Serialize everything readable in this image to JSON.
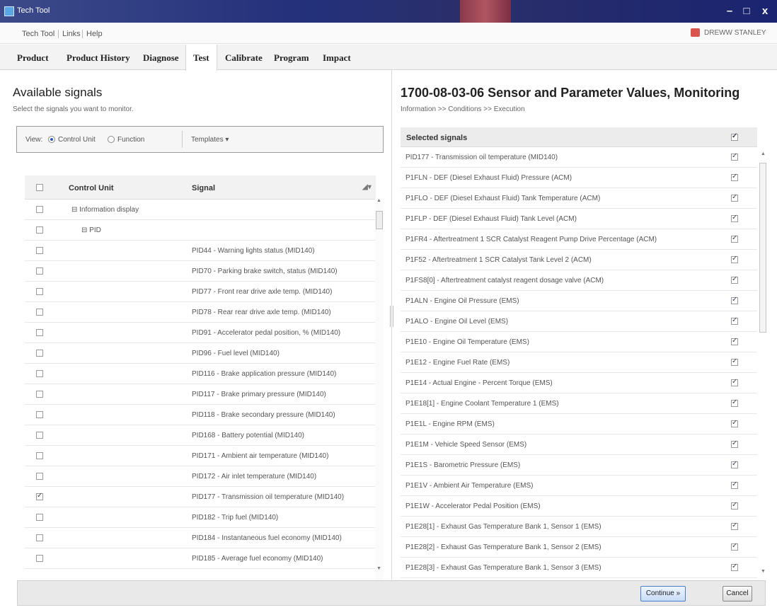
{
  "window": {
    "title": "Tech Tool"
  },
  "menu": {
    "items": [
      "Tech Tool",
      "Links",
      "Help"
    ],
    "user": "DREWW STANLEY"
  },
  "tabs": [
    "Product",
    "Product History",
    "Diagnose",
    "Test",
    "Calibrate",
    "Program",
    "Impact"
  ],
  "active_tab": "Test",
  "left": {
    "title": "Available signals",
    "subtitle": "Select the signals you want to monitor.",
    "view_label": "View:",
    "view_options": [
      "Control Unit",
      "Function"
    ],
    "view_selected": "Control Unit",
    "templates_label": "Templates ▾",
    "columns": {
      "control_unit": "Control Unit",
      "signal": "Signal"
    },
    "rows": [
      {
        "unit": "⊟ Information display",
        "signal": "",
        "checked": false
      },
      {
        "unit": "⊟ PID",
        "signal": "",
        "checked": false
      },
      {
        "unit": "",
        "signal": "PID44 - Warning lights status (MID140)",
        "checked": false
      },
      {
        "unit": "",
        "signal": "PID70 - Parking brake switch, status (MID140)",
        "checked": false
      },
      {
        "unit": "",
        "signal": "PID77 - Front rear drive axle temp. (MID140)",
        "checked": false
      },
      {
        "unit": "",
        "signal": "PID78 - Rear rear drive axle temp. (MID140)",
        "checked": false
      },
      {
        "unit": "",
        "signal": "PID91 - Accelerator pedal position, % (MID140)",
        "checked": false
      },
      {
        "unit": "",
        "signal": "PID96 - Fuel level (MID140)",
        "checked": false
      },
      {
        "unit": "",
        "signal": "PID116 - Brake application pressure (MID140)",
        "checked": false
      },
      {
        "unit": "",
        "signal": "PID117 - Brake primary pressure (MID140)",
        "checked": false
      },
      {
        "unit": "",
        "signal": "PID118 - Brake secondary pressure (MID140)",
        "checked": false
      },
      {
        "unit": "",
        "signal": "PID168 - Battery potential (MID140)",
        "checked": false
      },
      {
        "unit": "",
        "signal": "PID171 - Ambient air temperature (MID140)",
        "checked": false
      },
      {
        "unit": "",
        "signal": "PID172 - Air inlet temperature (MID140)",
        "checked": false
      },
      {
        "unit": "",
        "signal": "PID177 - Transmission oil temperature (MID140)",
        "checked": true
      },
      {
        "unit": "",
        "signal": "PID182 - Trip fuel (MID140)",
        "checked": false
      },
      {
        "unit": "",
        "signal": "PID184 - Instantaneous fuel economy (MID140)",
        "checked": false
      },
      {
        "unit": "",
        "signal": "PID185 - Average fuel economy (MID140)",
        "checked": false
      }
    ]
  },
  "right": {
    "title": "1700-08-03-06 Sensor and Parameter Values, Monitoring",
    "breadcrumb": "Information >> Conditions >> Execution",
    "selected_header": "Selected signals",
    "signals": [
      "PID177 - Transmission oil temperature (MID140)",
      "P1FLN - DEF (Diesel Exhaust Fluid) Pressure (ACM)",
      "P1FLO - DEF (Diesel Exhaust Fluid) Tank Temperature (ACM)",
      "P1FLP - DEF (Diesel Exhaust Fluid) Tank Level (ACM)",
      "P1FR4 - Aftertreatment 1 SCR Catalyst Reagent Pump Drive Percentage (ACM)",
      "P1F52 - Aftertreatment 1 SCR Catalyst Tank Level 2 (ACM)",
      "P1FS8[0] - Aftertreatment catalyst reagent dosage valve (ACM)",
      "P1ALN - Engine Oil Pressure (EMS)",
      "P1ALO - Engine Oil Level (EMS)",
      "P1E10 - Engine Oil Temperature (EMS)",
      "P1E12 - Engine Fuel Rate (EMS)",
      "P1E14 - Actual Engine - Percent Torque (EMS)",
      "P1E18[1] - Engine Coolant Temperature 1 (EMS)",
      "P1E1L - Engine RPM (EMS)",
      "P1E1M - Vehicle Speed Sensor (EMS)",
      "P1E1S - Barometric Pressure (EMS)",
      "P1E1V - Ambient Air Temperature (EMS)",
      "P1E1W - Accelerator Pedal Position (EMS)",
      "P1E28[1] - Exhaust Gas Temperature Bank 1, Sensor 1 (EMS)",
      "P1E28[2] - Exhaust Gas Temperature Bank 1, Sensor 2 (EMS)",
      "P1E28[3] - Exhaust Gas Temperature Bank 1, Sensor 3 (EMS)"
    ]
  },
  "footer": {
    "continue_label": "Continue »",
    "cancel_label": "Cancel"
  }
}
